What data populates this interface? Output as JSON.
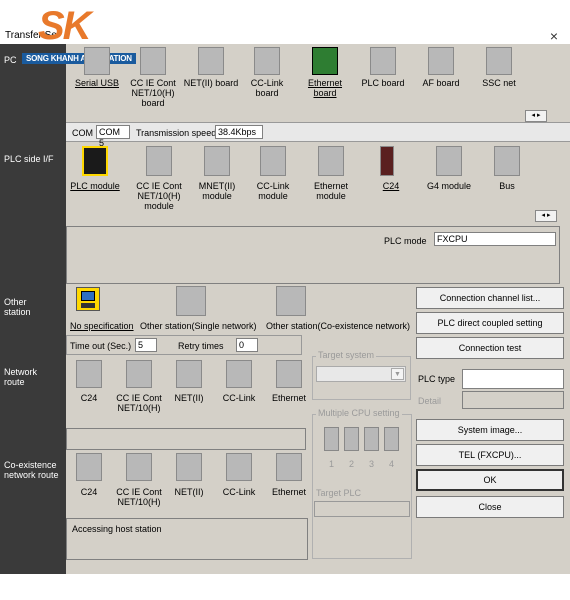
{
  "window": {
    "title": "Transfer Se",
    "close": "×"
  },
  "logo": {
    "brand": "SK",
    "tagline": "SONG KHANH AUTOMATION"
  },
  "left_labels": {
    "pc_side": "PC",
    "plc_side": "PLC side I/F",
    "other_station": "Other station",
    "network_route": "Network route",
    "coexistence": "Co-existence network route"
  },
  "pc_side_items": [
    {
      "label": "Serial USB"
    },
    {
      "label": "CC IE Cont NET/10(H) board"
    },
    {
      "label": "NET(II) board"
    },
    {
      "label": "CC-Link board"
    },
    {
      "label": "Ethernet board"
    },
    {
      "label": "PLC board"
    },
    {
      "label": "AF board"
    },
    {
      "label": "SSC net"
    }
  ],
  "com_bar": {
    "label": "COM",
    "value": "COM 5",
    "speed_label": "Transmission speed",
    "speed_value": "38.4Kbps"
  },
  "plc_side_items": [
    {
      "label": "PLC module"
    },
    {
      "label": "CC IE Cont NET/10(H) module"
    },
    {
      "label": "MNET(II) module"
    },
    {
      "label": "CC-Link module"
    },
    {
      "label": "Ethernet module"
    },
    {
      "label": "C24"
    },
    {
      "label": "G4 module"
    },
    {
      "label": "Bus"
    }
  ],
  "plc_mode": {
    "label": "PLC mode",
    "value": "FXCPU"
  },
  "other_station_items": [
    {
      "label": "No specification"
    },
    {
      "label": "Other station(Single network)"
    },
    {
      "label": "Other station(Co-existence network)"
    }
  ],
  "timeout": {
    "label": "Time out (Sec.)",
    "value": "5",
    "retry_label": "Retry times",
    "retry_value": "0"
  },
  "network_items": [
    {
      "label": "C24"
    },
    {
      "label": "CC IE Cont NET/10(H)"
    },
    {
      "label": "NET(II)"
    },
    {
      "label": "CC-Link"
    },
    {
      "label": "Ethernet"
    }
  ],
  "coexist_items": [
    {
      "label": "C24"
    },
    {
      "label": "CC IE Cont NET/10(H)"
    },
    {
      "label": "NET(II)"
    },
    {
      "label": "CC-Link"
    },
    {
      "label": "Ethernet"
    }
  ],
  "target_system": {
    "label": "Target system"
  },
  "multi_cpu": {
    "label": "Multiple CPU setting",
    "n1": "1",
    "n2": "2",
    "n3": "3",
    "n4": "4",
    "target_plc": "Target PLC"
  },
  "right_buttons": {
    "connection_list": "Connection  channel  list...",
    "plc_direct": "PLC direct coupled setting",
    "connection_test": "Connection test",
    "system_image": "System  image...",
    "tel": "TEL (FXCPU)...",
    "ok": "OK",
    "close": "Close"
  },
  "plc_type": {
    "label": "PLC type",
    "detail": "Detail"
  },
  "status": {
    "message": "Accessing host station"
  },
  "scroll": {
    "arrows": "◂ ▸"
  }
}
